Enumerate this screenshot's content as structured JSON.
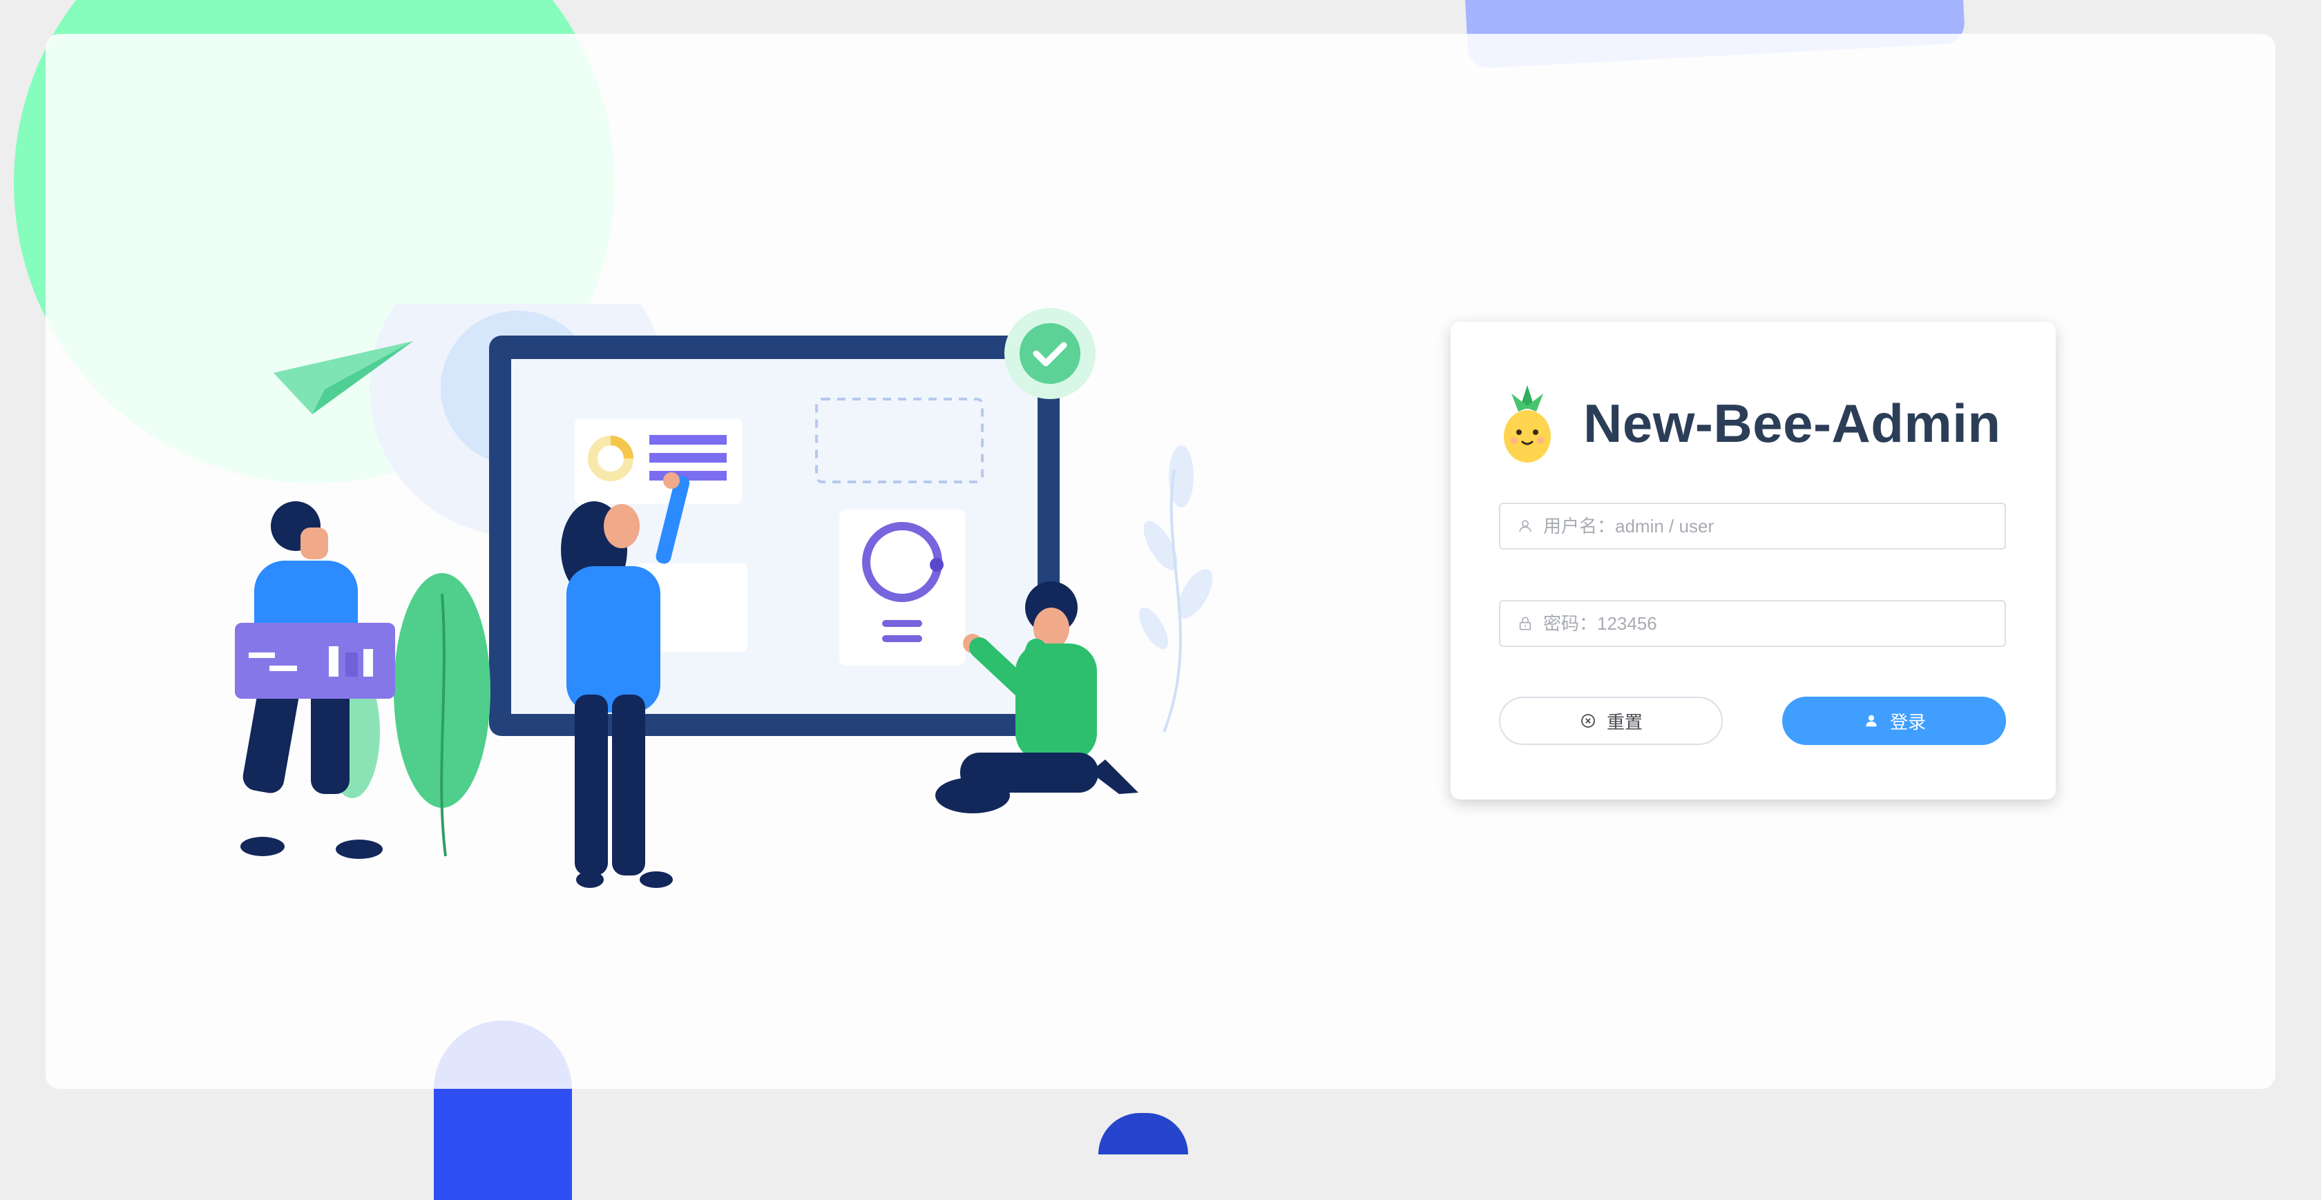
{
  "app": {
    "title": "New-Bee-Admin"
  },
  "login": {
    "username_placeholder": "用户名：admin / user",
    "password_placeholder": "密码：123456",
    "reset_label": "重置",
    "login_label": "登录"
  },
  "icons": {
    "logo": "pineapple-logo-icon",
    "username": "user-icon",
    "password": "lock-icon",
    "reset": "circle-x-icon",
    "login": "user-filled-icon"
  },
  "colors": {
    "primary": "#409eff",
    "title_text": "#2c3e57",
    "decor_green": "#86fcbd",
    "decor_purple": "#a4b4ff",
    "decor_blue": "#2f4ff2"
  }
}
